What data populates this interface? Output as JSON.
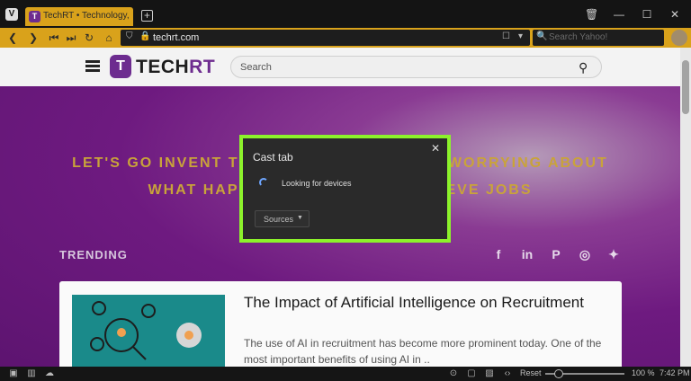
{
  "browser": {
    "tab_title": "TechRT • Technology, Real",
    "url": "techrt.com",
    "search_placeholder": "Search Yahoo!",
    "new_tab_icon": "plus-icon",
    "accent_color": "#d9a21b"
  },
  "site": {
    "logo_letter": "T",
    "logo_text_dark": "TECH",
    "logo_text_accent": "RT",
    "search_placeholder": "Search",
    "hero_line_1": "LET'S GO INVENT TOMORROW INSTEAD OF WORRYING ABOUT",
    "hero_line_2": "WHAT HAPPENED YESTERDAY - STEVE JOBS",
    "trending_label": "TRENDING",
    "social_icons": [
      "facebook-icon",
      "linkedin-icon",
      "pinterest-icon",
      "instagram-icon",
      "twitter-icon"
    ],
    "article": {
      "title": "The Impact of Artificial Intelligence on Recruitment",
      "excerpt": "The use of AI in recruitment has become more prominent today. One of the most important benefits of using AI in .."
    }
  },
  "cast_dialog": {
    "title": "Cast tab",
    "status": "Looking for devices",
    "sources_label": "Sources",
    "highlight_color": "#8cf22b"
  },
  "statusbar": {
    "reset_label": "Reset",
    "zoom": "100 %",
    "time": "7:42 PM"
  }
}
